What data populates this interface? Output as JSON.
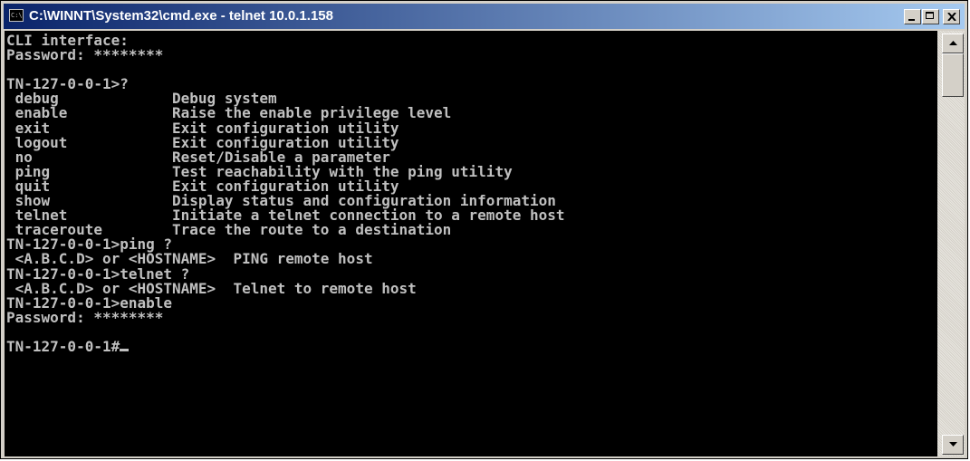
{
  "window": {
    "title": "C:\\WINNT\\System32\\cmd.exe - telnet 10.0.1.158",
    "controls": {
      "minimize": "minimize",
      "maximize": "maximize",
      "close": "close"
    }
  },
  "console": {
    "lines": [
      "CLI interface:",
      "Password: ********",
      "",
      "TN-127-0-0-1>?",
      " debug             Debug system",
      " enable            Raise the enable privilege level",
      " exit              Exit configuration utility",
      " logout            Exit configuration utility",
      " no                Reset/Disable a parameter",
      " ping              Test reachability with the ping utility",
      " quit              Exit configuration utility",
      " show              Display status and configuration information",
      " telnet            Initiate a telnet connection to a remote host",
      " traceroute        Trace the route to a destination",
      "TN-127-0-0-1>ping ?",
      " <A.B.C.D> or <HOSTNAME>  PING remote host",
      "TN-127-0-0-1>telnet ?",
      " <A.B.C.D> or <HOSTNAME>  Telnet to remote host",
      "TN-127-0-0-1>enable",
      "Password: ********",
      "",
      "TN-127-0-0-1#"
    ]
  },
  "colors": {
    "console_bg": "#000000",
    "console_fg": "#c0c0c0",
    "titlebar_start": "#0a246a",
    "titlebar_end": "#a6caf0"
  },
  "icons": {
    "app": "console-icon",
    "scroll_up": "arrow-up-icon",
    "scroll_down": "arrow-down-icon"
  }
}
